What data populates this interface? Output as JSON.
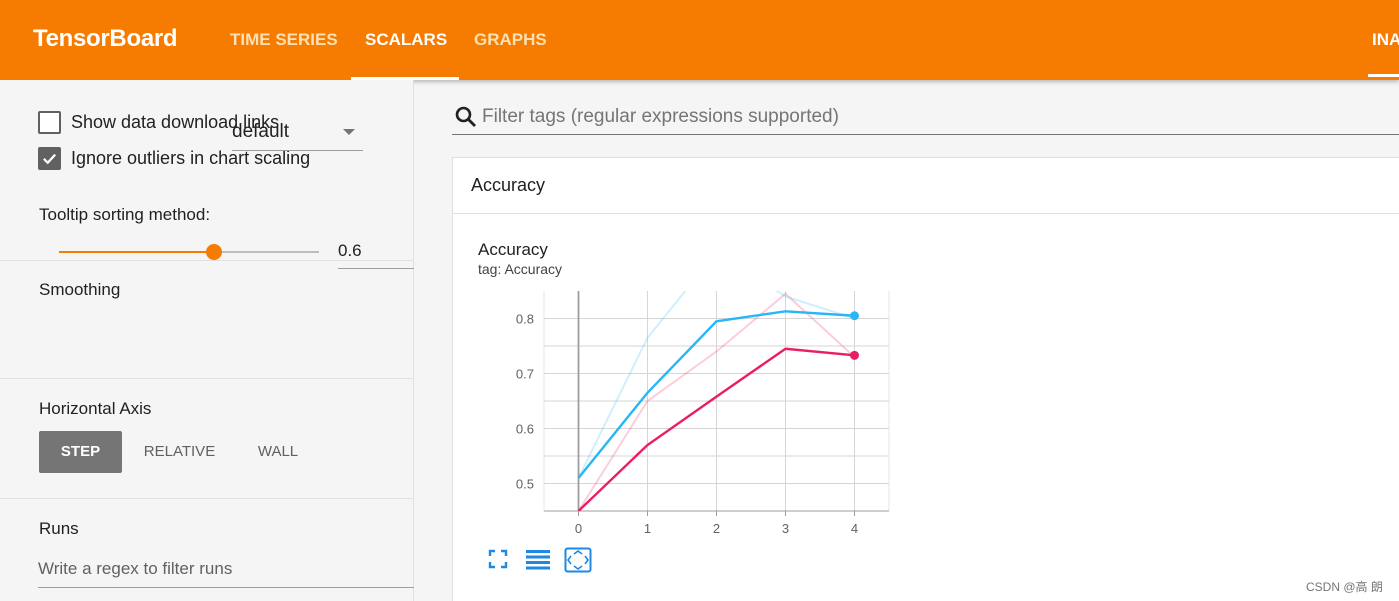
{
  "header": {
    "brand": "TensorBoard",
    "tabs": [
      {
        "label": "TIME SERIES",
        "active": false
      },
      {
        "label": "SCALARS",
        "active": true
      },
      {
        "label": "GRAPHS",
        "active": false
      }
    ],
    "right_tab": "INA"
  },
  "sidebar": {
    "show_download_links": {
      "label": "Show data download links",
      "checked": false
    },
    "ignore_outliers": {
      "label": "Ignore outliers in chart scaling",
      "checked": true
    },
    "tooltip_sort": {
      "label": "Tooltip sorting method:",
      "value": "default"
    },
    "smoothing": {
      "label": "Smoothing",
      "value": "0.6",
      "fraction": 0.6
    },
    "horizontal_axis": {
      "label": "Horizontal Axis",
      "options": [
        "STEP",
        "RELATIVE",
        "WALL"
      ],
      "selected": "STEP"
    },
    "runs": {
      "label": "Runs",
      "placeholder": "Write a regex to filter runs"
    }
  },
  "main": {
    "filter_placeholder": "Filter tags (regular expressions supported)",
    "card_title": "Accuracy",
    "chart_title": "Accuracy",
    "chart_tag": "tag: Accuracy"
  },
  "chart_data": {
    "type": "line",
    "x": [
      0,
      1,
      2,
      3,
      4
    ],
    "xticks": [
      "0",
      "1",
      "2",
      "3",
      "4"
    ],
    "yticks": [
      "0.5",
      "0.6",
      "0.7",
      "0.8"
    ],
    "ylim": [
      0.45,
      0.85
    ],
    "xlim": [
      -0.5,
      4.5
    ],
    "grid": true,
    "legend": "none",
    "series": [
      {
        "color": "#29b6f6",
        "smoothed": [
          0.51,
          0.665,
          0.795,
          0.813,
          0.805
        ],
        "raw": [
          0.51,
          0.765,
          0.92,
          0.84,
          0.8
        ]
      },
      {
        "color": "#e91e63",
        "smoothed": [
          0.45,
          0.57,
          0.658,
          0.745,
          0.733
        ],
        "raw": [
          0.45,
          0.65,
          0.74,
          0.845,
          0.73
        ]
      }
    ]
  },
  "footer": {
    "watermark": "CSDN @高 朗"
  }
}
